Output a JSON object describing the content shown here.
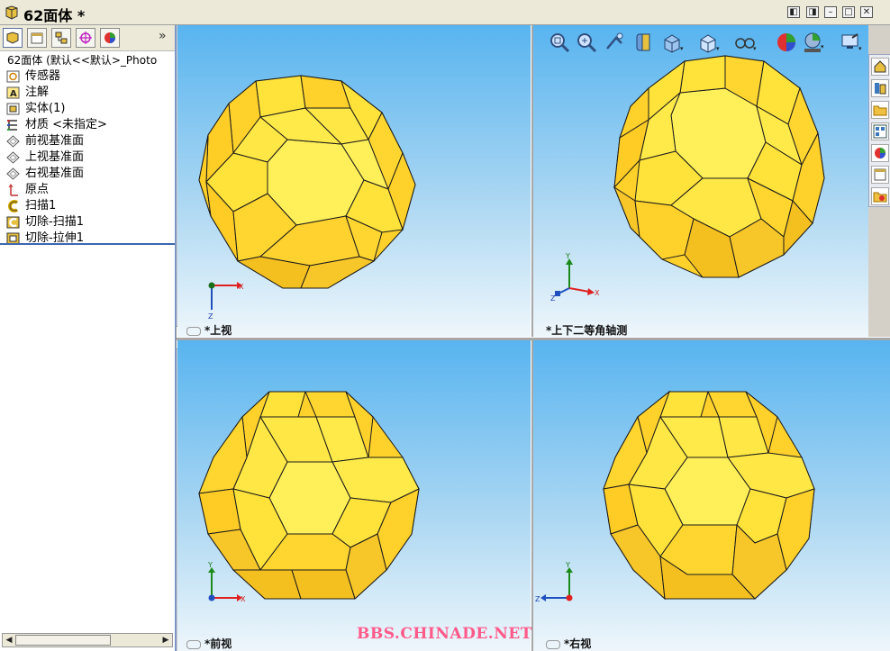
{
  "window": {
    "title": "62面体 *",
    "buttons": [
      "restore-down",
      "restore-up",
      "minimize",
      "maximize",
      "close"
    ]
  },
  "feature_manager": {
    "tabs": [
      "feature-tree",
      "property-manager",
      "configuration-manager",
      "dimxpert",
      "display-manager"
    ],
    "more": "»",
    "root": "62面体  (默认<<默认>_Photo",
    "items": [
      {
        "label": "传感器",
        "icon": "sensor-icon"
      },
      {
        "label": "注解",
        "icon": "annotation-icon"
      },
      {
        "label": "实体(1)",
        "icon": "solid-body-icon"
      },
      {
        "label": "材质 <未指定>",
        "icon": "material-icon"
      },
      {
        "label": "前视基准面",
        "icon": "plane-icon"
      },
      {
        "label": "上视基准面",
        "icon": "plane-icon"
      },
      {
        "label": "右视基准面",
        "icon": "plane-icon"
      },
      {
        "label": "原点",
        "icon": "origin-icon"
      },
      {
        "label": "扫描1",
        "icon": "sweep-icon"
      },
      {
        "label": "切除-扫描1",
        "icon": "cut-sweep-icon"
      },
      {
        "label": "切除-拉伸1",
        "icon": "cut-extrude-icon"
      }
    ]
  },
  "viewports": [
    {
      "name": "top",
      "label": "*上视",
      "axes": [
        "X",
        "Z"
      ]
    },
    {
      "name": "trimetric",
      "label": "*上下二等角轴测",
      "axes": [
        "Y",
        "X",
        "Z"
      ]
    },
    {
      "name": "front",
      "label": "*前视",
      "axes": [
        "Y",
        "X"
      ]
    },
    {
      "name": "right",
      "label": "*右视",
      "axes": [
        "Y",
        "Z"
      ]
    }
  ],
  "heads_up_toolbar": [
    "zoom-to-fit-icon",
    "zoom-to-area-icon",
    "previous-view-icon",
    "section-view-icon",
    "view-orientation-icon",
    "display-style-icon",
    "hide-show-items-icon",
    "edit-appearance-icon",
    "apply-scene-icon",
    "view-settings-icon"
  ],
  "task_pane": [
    "solidworks-resources-icon",
    "design-library-icon",
    "file-explorer-icon",
    "view-palette-icon",
    "appearances-icon",
    "custom-properties-icon",
    "document-recovery-icon"
  ],
  "watermark": "BBS.CHINADE.NET",
  "colors": {
    "face": "#ffe23a",
    "edge": "#1a1a1a",
    "accent": "#3c66b0"
  }
}
